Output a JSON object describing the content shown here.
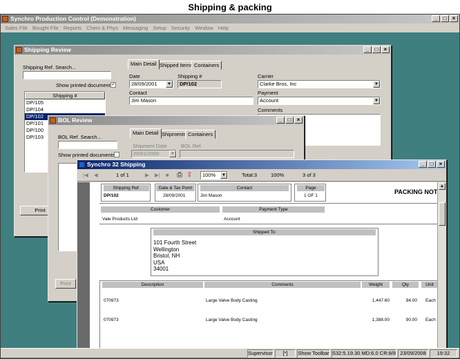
{
  "page_title": "Shipping & packing",
  "app": {
    "title": "Synchro Production Control (Demonstration)",
    "menu": [
      "Sales File",
      "Bought File",
      "Reports",
      "Chem & Phys",
      "Messaging",
      "Setup",
      "Security",
      "Window",
      "Help"
    ]
  },
  "shipping_review": {
    "title": "Shipping Review",
    "search_label": "Shipping Ref. Search...",
    "show_printed_label": "Show printed documents",
    "show_printed_checked": "✓",
    "list_header": "Shipping #",
    "list_items": [
      "DP/105",
      "DP/104",
      "DP/102",
      "DP/101",
      "DP/100",
      "DP/103"
    ],
    "selected_item": "DP/102",
    "print_button": "Print",
    "tabs": [
      "Main Detail",
      "Shipped Items",
      "Containers"
    ],
    "date_label": "Date",
    "date_value": "28/09/2001",
    "shipping_no_label": "Shipping #",
    "shipping_no_value": "DP/102",
    "contact_label": "Contact",
    "contact_value": "Jim Mason",
    "carrier_label": "Carrier",
    "carrier_value": "Clarke Bros, Inc",
    "payment_label": "Payment",
    "payment_value": "Account",
    "comments_label": "Comments"
  },
  "bol_review": {
    "title": "BOL Review",
    "search_label": "BOL Ref. Search...",
    "show_printed_label": "Show printed documents",
    "tabs": [
      "Main Detail",
      "Shipments",
      "Containers"
    ],
    "shipment_date_label": "Shipment Date",
    "shipment_date_value": "20/01/2000",
    "bol_ref_label": "BOL Ref.",
    "print_button": "Print"
  },
  "report_window": {
    "title": "Synchro 32 Shipping",
    "page_indicator": "1 of 1",
    "zoom_value": "100%",
    "total_label": "Total:3",
    "zoom_text": "100%",
    "count_label": "3 of 3",
    "document": {
      "heading": "PACKING NOTE",
      "shipping_ref_header": "Shipping Ref.",
      "shipping_ref_value": "DP/102",
      "date_tax_header": "Date & Tax Point",
      "date_tax_value": "28/09/2001",
      "contact_header": "Contact",
      "contact_value": "Jim Mason",
      "page_header": "Page",
      "page_value": "1 OF 1",
      "customer_header": "Customer",
      "customer_value": "Vale Products Ltd",
      "payment_type_header": "Payment Type",
      "payment_type_value": "Account",
      "shipped_to_header": "Shipped To:",
      "shipped_to_lines": [
        "101 Fourth Street",
        "Wellington",
        "Bristol, NH",
        "USA",
        "34001"
      ],
      "columns": [
        "Description",
        "Comments",
        "Weight",
        "Qty",
        "Unit"
      ],
      "rows": [
        {
          "description": "070973",
          "comments": "Large Valve Body Casting",
          "weight": "1,447.60",
          "qty": "94.00",
          "unit": "Each"
        },
        {
          "description": "070973",
          "comments": "Large Valve Body Casting",
          "weight": "1,388.00",
          "qty": "90.00",
          "unit": "Each"
        }
      ]
    }
  },
  "status_bar": {
    "user": "Supervisor",
    "flag": "[*]",
    "show_toolbar": "Show Toolbar",
    "server": "S32:5.19.30 MD:6.0 CR:8/8.5",
    "date": "23/09/2008",
    "time": "19:32"
  }
}
